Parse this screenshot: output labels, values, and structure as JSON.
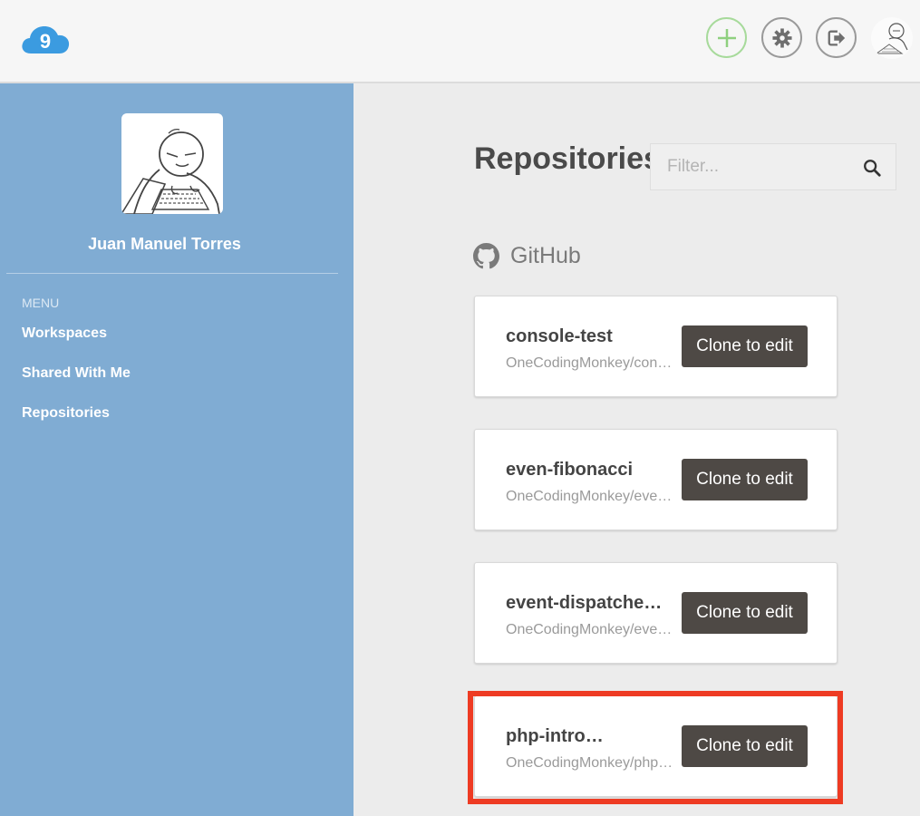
{
  "colors": {
    "sidebar": "#80acd3",
    "topbar": "#f6f6f6",
    "main_bg": "#ececec",
    "clone_button": "#4e4945",
    "add_button_border": "#a7da9b",
    "logo": "#3b9be0",
    "highlight": "#ee3b23"
  },
  "header": {
    "logo_icon": "cloud9-logo-icon",
    "logo_text": "9",
    "actions": [
      {
        "icon": "plus-icon",
        "name": "add-workspace-button"
      },
      {
        "icon": "gear-icon",
        "name": "settings-button"
      },
      {
        "icon": "logout-icon",
        "name": "logout-button"
      },
      {
        "icon": "avatar-icon",
        "name": "user-avatar"
      }
    ]
  },
  "sidebar": {
    "user_name": "Juan Manuel Torres",
    "menu_label": "MENU",
    "items": [
      {
        "label": "Workspaces"
      },
      {
        "label": "Shared With Me"
      },
      {
        "label": "Repositories"
      }
    ]
  },
  "main": {
    "title": "Repositories",
    "filter": {
      "placeholder": "Filter...",
      "value": ""
    },
    "provider": {
      "icon": "github-icon",
      "label": "GitHub"
    },
    "repos": [
      {
        "name": "console-test",
        "path": "OneCodingMonkey/con…",
        "button": "Clone to edit"
      },
      {
        "name": "even-fibonacci",
        "path": "OneCodingMonkey/even…",
        "button": "Clone to edit"
      },
      {
        "name": "event-dispatcher…",
        "path": "OneCodingMonkey/eve…",
        "button": "Clone to edit"
      },
      {
        "name": "php-intro…",
        "path": "OneCodingMonkey/php…",
        "button": "Clone to edit"
      }
    ]
  }
}
